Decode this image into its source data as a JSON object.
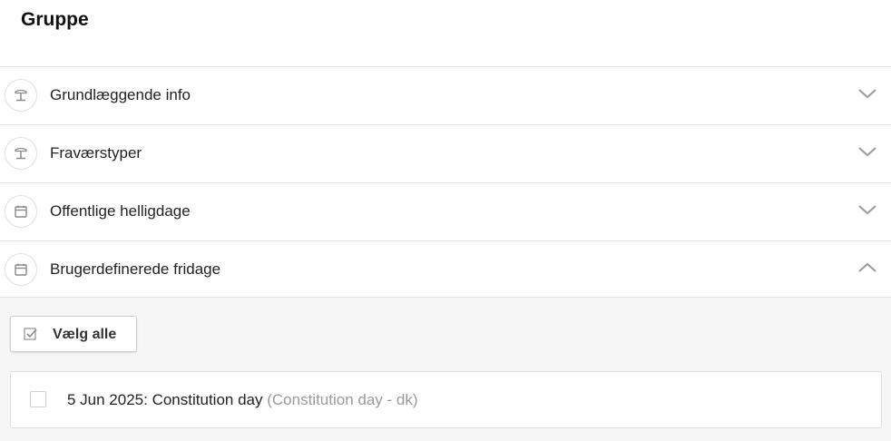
{
  "page": {
    "title": "Gruppe"
  },
  "sections": [
    {
      "label": "Grundlæggende info",
      "icon": "palm-tree-icon",
      "expanded": false
    },
    {
      "label": "Fraværstyper",
      "icon": "palm-tree-icon",
      "expanded": false
    },
    {
      "label": "Offentlige helligdage",
      "icon": "calendar-icon",
      "expanded": false
    },
    {
      "label": "Brugerdefinerede fridage",
      "icon": "calendar-icon",
      "expanded": true
    }
  ],
  "custom_days": {
    "select_all_label": "Vælg alle",
    "items": [
      {
        "date_name": "5 Jun 2025: Constitution day",
        "detail": "(Constitution day - dk)",
        "checked": false
      }
    ]
  },
  "colors": {
    "icon_gray": "#8a8a8a",
    "chevron_gray": "#9a9a9a",
    "muted_text": "#9a9a9a"
  }
}
